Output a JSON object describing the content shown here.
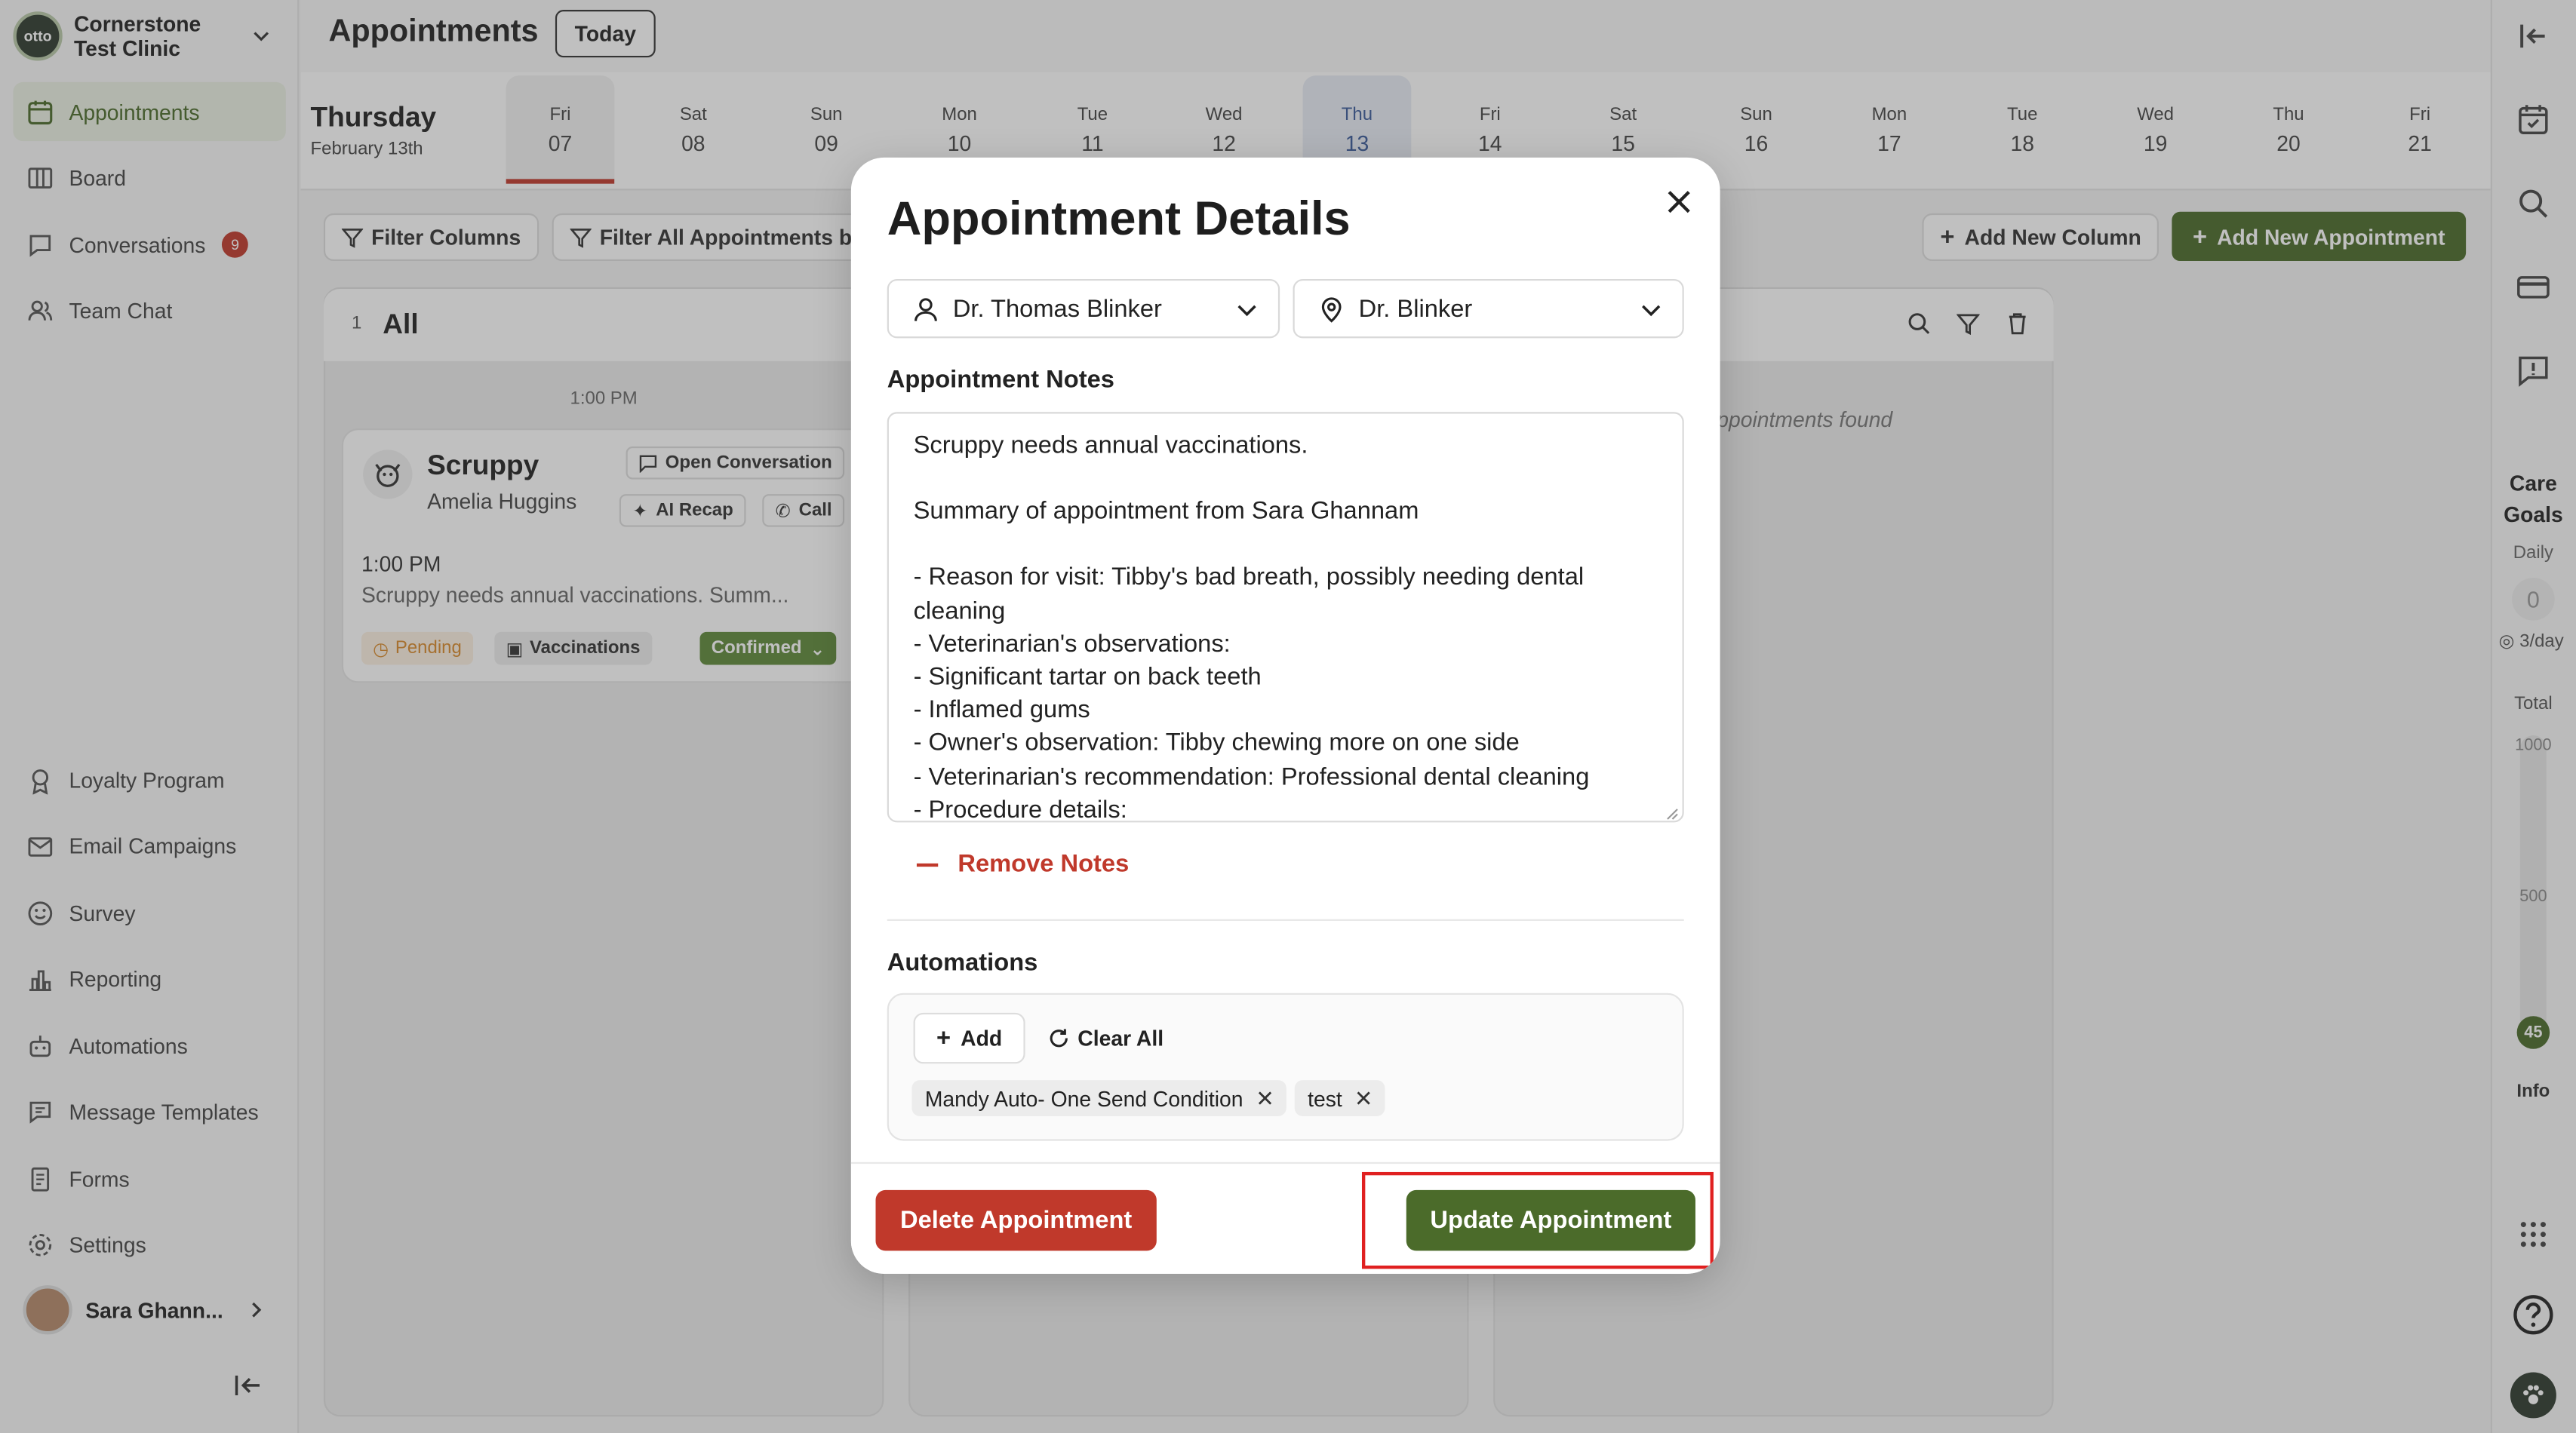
{
  "clinic": {
    "name_line1": "Cornerstone",
    "name_line2": "Test Clinic",
    "logo_text": "otto"
  },
  "sidebar": {
    "items": [
      {
        "label": "Appointments",
        "icon": "calendar-icon"
      },
      {
        "label": "Board",
        "icon": "board-icon"
      },
      {
        "label": "Conversations",
        "icon": "chat-icon",
        "badge": "9"
      },
      {
        "label": "Team Chat",
        "icon": "team-icon"
      },
      {
        "label": "Loyalty Program",
        "icon": "award-icon"
      },
      {
        "label": "Email Campaigns",
        "icon": "mail-icon"
      },
      {
        "label": "Survey",
        "icon": "smile-icon"
      },
      {
        "label": "Reporting",
        "icon": "bar-chart-icon"
      },
      {
        "label": "Automations",
        "icon": "robot-icon"
      },
      {
        "label": "Message Templates",
        "icon": "template-icon"
      },
      {
        "label": "Forms",
        "icon": "form-icon"
      },
      {
        "label": "Settings",
        "icon": "gear-icon"
      }
    ],
    "user_name": "Sara Ghann..."
  },
  "header": {
    "title": "Appointments",
    "today_label": "Today"
  },
  "date_bar": {
    "weekday": "Thursday",
    "date": "February 13th",
    "days": [
      {
        "dow": "Fri",
        "num": "07"
      },
      {
        "dow": "Sat",
        "num": "08"
      },
      {
        "dow": "Sun",
        "num": "09"
      },
      {
        "dow": "Mon",
        "num": "10"
      },
      {
        "dow": "Tue",
        "num": "11"
      },
      {
        "dow": "Wed",
        "num": "12"
      },
      {
        "dow": "Thu",
        "num": "13"
      },
      {
        "dow": "Fri",
        "num": "14"
      },
      {
        "dow": "Sat",
        "num": "15"
      },
      {
        "dow": "Sun",
        "num": "16"
      },
      {
        "dow": "Mon",
        "num": "17"
      },
      {
        "dow": "Tue",
        "num": "18"
      },
      {
        "dow": "Wed",
        "num": "19"
      },
      {
        "dow": "Thu",
        "num": "20"
      },
      {
        "dow": "Fri",
        "num": "21"
      }
    ]
  },
  "toolbar": {
    "filter_columns": "Filter Columns",
    "filter_all": "Filter All Appointments b",
    "add_column": "Add New Column",
    "add_appointment": "Add New Appointment"
  },
  "column_all": {
    "count": "1",
    "title": "All",
    "time_marker": "1:00 PM"
  },
  "card": {
    "pet": "Scruppy",
    "owner": "Amelia Huggins",
    "open_conversation": "Open Conversation",
    "ai_recap": "AI Recap",
    "call": "Call",
    "time": "1:00 PM",
    "snippet": "Scruppy needs annual vaccinations. Summ...",
    "status_pending": "Pending",
    "type": "Vaccinations",
    "confirmed": "Confirmed"
  },
  "column_empty": {
    "message": "ppointments found"
  },
  "right_rail": {
    "care_goals_1": "Care",
    "care_goals_2": "Goals",
    "daily": "Daily",
    "daily_value": "0",
    "per_day": "3/day",
    "total": "Total",
    "tick_1000": "1000",
    "tick_500": "500",
    "progress_value": "45",
    "info": "Info"
  },
  "modal": {
    "title": "Appointment Details",
    "doctor": "Dr. Thomas Blinker",
    "location": "Dr. Blinker",
    "notes_label": "Appointment Notes",
    "notes_lines": [
      "Scruppy needs annual vaccinations.",
      "",
      "Summary of appointment from Sara Ghannam",
      "",
      "- Reason for visit: Tibby's bad breath, possibly needing dental cleaning",
      "- Veterinarian's observations:",
      "- Significant tartar on back teeth",
      "- Inflamed gums",
      "- Owner's observation: Tibby chewing more on one side",
      "- Veterinarian's recommendation: Professional dental cleaning",
      "- Procedure details:"
    ],
    "remove_notes": "Remove Notes",
    "automations_label": "Automations",
    "add_label": "Add",
    "clear_all_label": "Clear All",
    "tags": [
      "Mandy Auto- One Send Condition",
      "test"
    ],
    "delete_label": "Delete Appointment",
    "update_label": "Update Appointment"
  },
  "colors": {
    "accent": "#4b6b2a",
    "danger": "#c0392b",
    "highlight": "#e02020"
  }
}
